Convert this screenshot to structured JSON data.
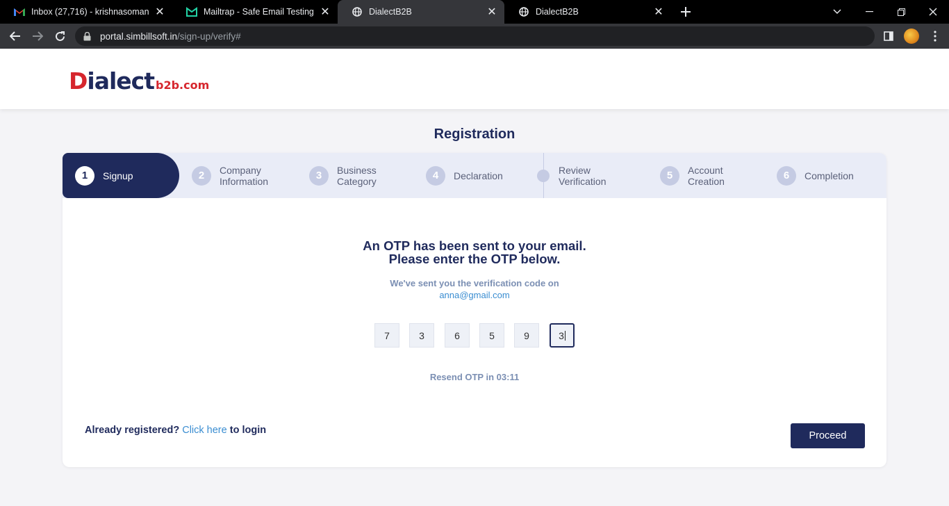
{
  "browser": {
    "tabs": [
      {
        "title": "Inbox (27,716) - krishnasomanna",
        "icon": "gmail-icon"
      },
      {
        "title": "Mailtrap - Safe Email Testing",
        "icon": "mailtrap-icon"
      },
      {
        "title": "DialectB2B",
        "icon": "globe-icon"
      },
      {
        "title": "DialectB2B",
        "icon": "globe-icon"
      }
    ],
    "url_host": "portal.simbillsoft.in",
    "url_path": "/sign-up/verify#"
  },
  "header": {
    "logo_d": "D",
    "logo_rest": "ialect",
    "logo_sub": "b2b.com"
  },
  "registration": {
    "title": "Registration",
    "steps": [
      {
        "num": "1",
        "label": "Signup"
      },
      {
        "num": "2",
        "label": "Company\nInformation"
      },
      {
        "num": "3",
        "label": "Business\nCategory"
      },
      {
        "num": "4",
        "label": "Declaration"
      },
      {
        "num": "",
        "label": "Review\nVerification"
      },
      {
        "num": "5",
        "label": "Account\nCreation"
      },
      {
        "num": "6",
        "label": "Completion"
      }
    ],
    "active_step": "Signup"
  },
  "otp": {
    "heading_line1": "An OTP has been sent to your email.",
    "heading_line2": "Please enter the OTP below.",
    "sub": "We've sent you the verification code on",
    "email": "anna@gmail.com",
    "digits": [
      "7",
      "3",
      "6",
      "5",
      "9",
      "3"
    ],
    "resend": "Resend OTP in 03:11"
  },
  "footer": {
    "already": "Already registered?",
    "link": "Click here",
    "to_login": "to login",
    "proceed": "Proceed"
  },
  "colors": {
    "primary": "#1f2a5c",
    "accent_red": "#d6262d",
    "link": "#3a8dd1",
    "step_bg": "#e9ecf7"
  }
}
